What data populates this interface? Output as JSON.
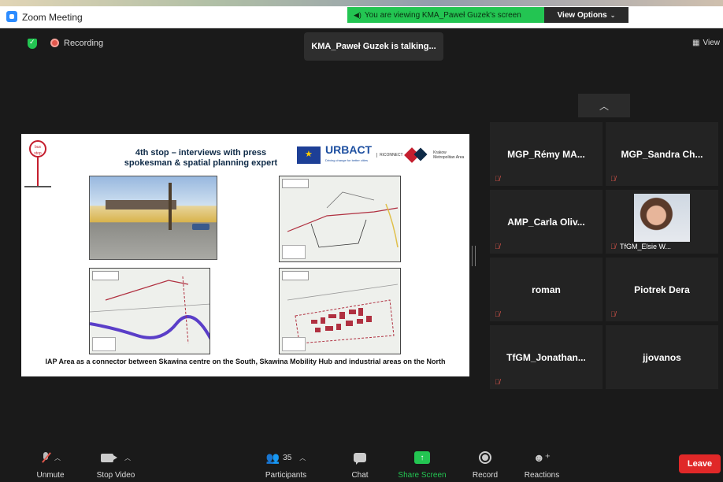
{
  "window": {
    "title": "Zoom Meeting"
  },
  "share_banner": {
    "text": "You are viewing KMA_Paweł Guzek's screen",
    "view_options": "View Options"
  },
  "topbar": {
    "recording": "Recording",
    "view": "View"
  },
  "talking": "KMA_Paweł Guzek is talking...",
  "slide": {
    "stop_sign": "bus stop",
    "title": "4th stop – interviews with press spokesman & spatial planning expert",
    "logo_urbact": "URBACT",
    "logo_urbact_tagline": "Driving change for better cities",
    "logo_riconnect": "RiCONNECT",
    "logo_kma": "Krakow Metropolitan Area",
    "caption": "IAP Area as a connector between Skawina centre on the South, Skawina Mobility Hub and industrial areas on the North"
  },
  "participants": [
    {
      "name": "MGP_Rémy MA...",
      "muted": true
    },
    {
      "name": "MGP_Sandra Ch...",
      "muted": true
    },
    {
      "name": "AMP_Carla Oliv...",
      "muted": true
    },
    {
      "name": "TfGM_Elsie W...",
      "muted": true,
      "video": true
    },
    {
      "name": "roman",
      "muted": true
    },
    {
      "name": "Piotrek Dera",
      "muted": true
    },
    {
      "name": "TfGM_Jonathan...",
      "muted": true
    },
    {
      "name": "jjovanos",
      "muted": false
    }
  ],
  "toolbar": {
    "unmute": "Unmute",
    "stop_video": "Stop Video",
    "participants": "Participants",
    "participant_count": "35",
    "chat": "Chat",
    "share_screen": "Share Screen",
    "record": "Record",
    "reactions": "Reactions",
    "leave": "Leave"
  },
  "colors": {
    "accent_green": "#23c552",
    "leave_red": "#e02828",
    "mute_red": "#e2574c"
  }
}
